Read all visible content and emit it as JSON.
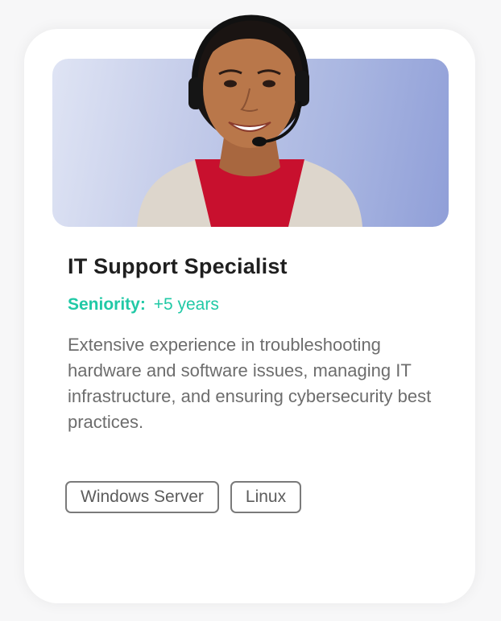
{
  "card": {
    "title": "IT Support Specialist",
    "seniority_label": "Seniority:",
    "seniority_value": "+5 years",
    "description": "Extensive experience in troubleshooting hardware and software issues, managing IT infrastructure, and ensuring cybersecurity best practices.",
    "tags": [
      "Windows Server",
      "Linux"
    ]
  },
  "colors": {
    "accent": "#21c9a6",
    "title": "#1f1f1f",
    "body_text": "#6d6d6d",
    "banner_start": "#dfe4f4",
    "banner_end": "#909fd8",
    "shirt": "#c8102e",
    "cardigan": "#ddd6cc"
  },
  "icons": {
    "portrait": "person-with-headset"
  }
}
